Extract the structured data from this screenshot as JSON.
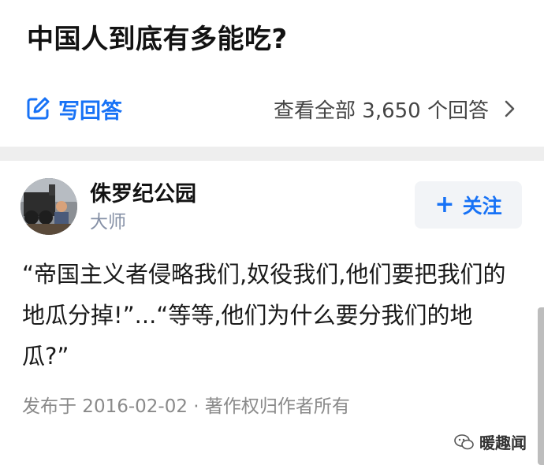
{
  "question": {
    "title": "中国人到底有多能吃?",
    "write_answer_label": "写回答",
    "view_all_label": "查看全部 3,650 个回答"
  },
  "answer": {
    "author_name": "侏罗纪公园",
    "author_badge": "大师",
    "follow_label": "关注",
    "follow_plus": "+",
    "content": "“帝国主义者侵略我们,奴役我们,他们要把我们的地瓜分掉!”...“等等,他们为什么要分我们的地瓜?”",
    "meta": "发布于 2016-02-02 · 著作权归作者所有"
  },
  "watermark": {
    "text": "暖趣闻"
  },
  "colors": {
    "accent": "#1772f6",
    "divider": "#eeeeee",
    "follow_bg": "#f2f4f7",
    "muted": "#8a8a8a"
  },
  "icons": {
    "write": "edit-icon",
    "chevron": "chevron-right-icon",
    "plus": "plus-icon",
    "watermark": "wechat-icon"
  }
}
